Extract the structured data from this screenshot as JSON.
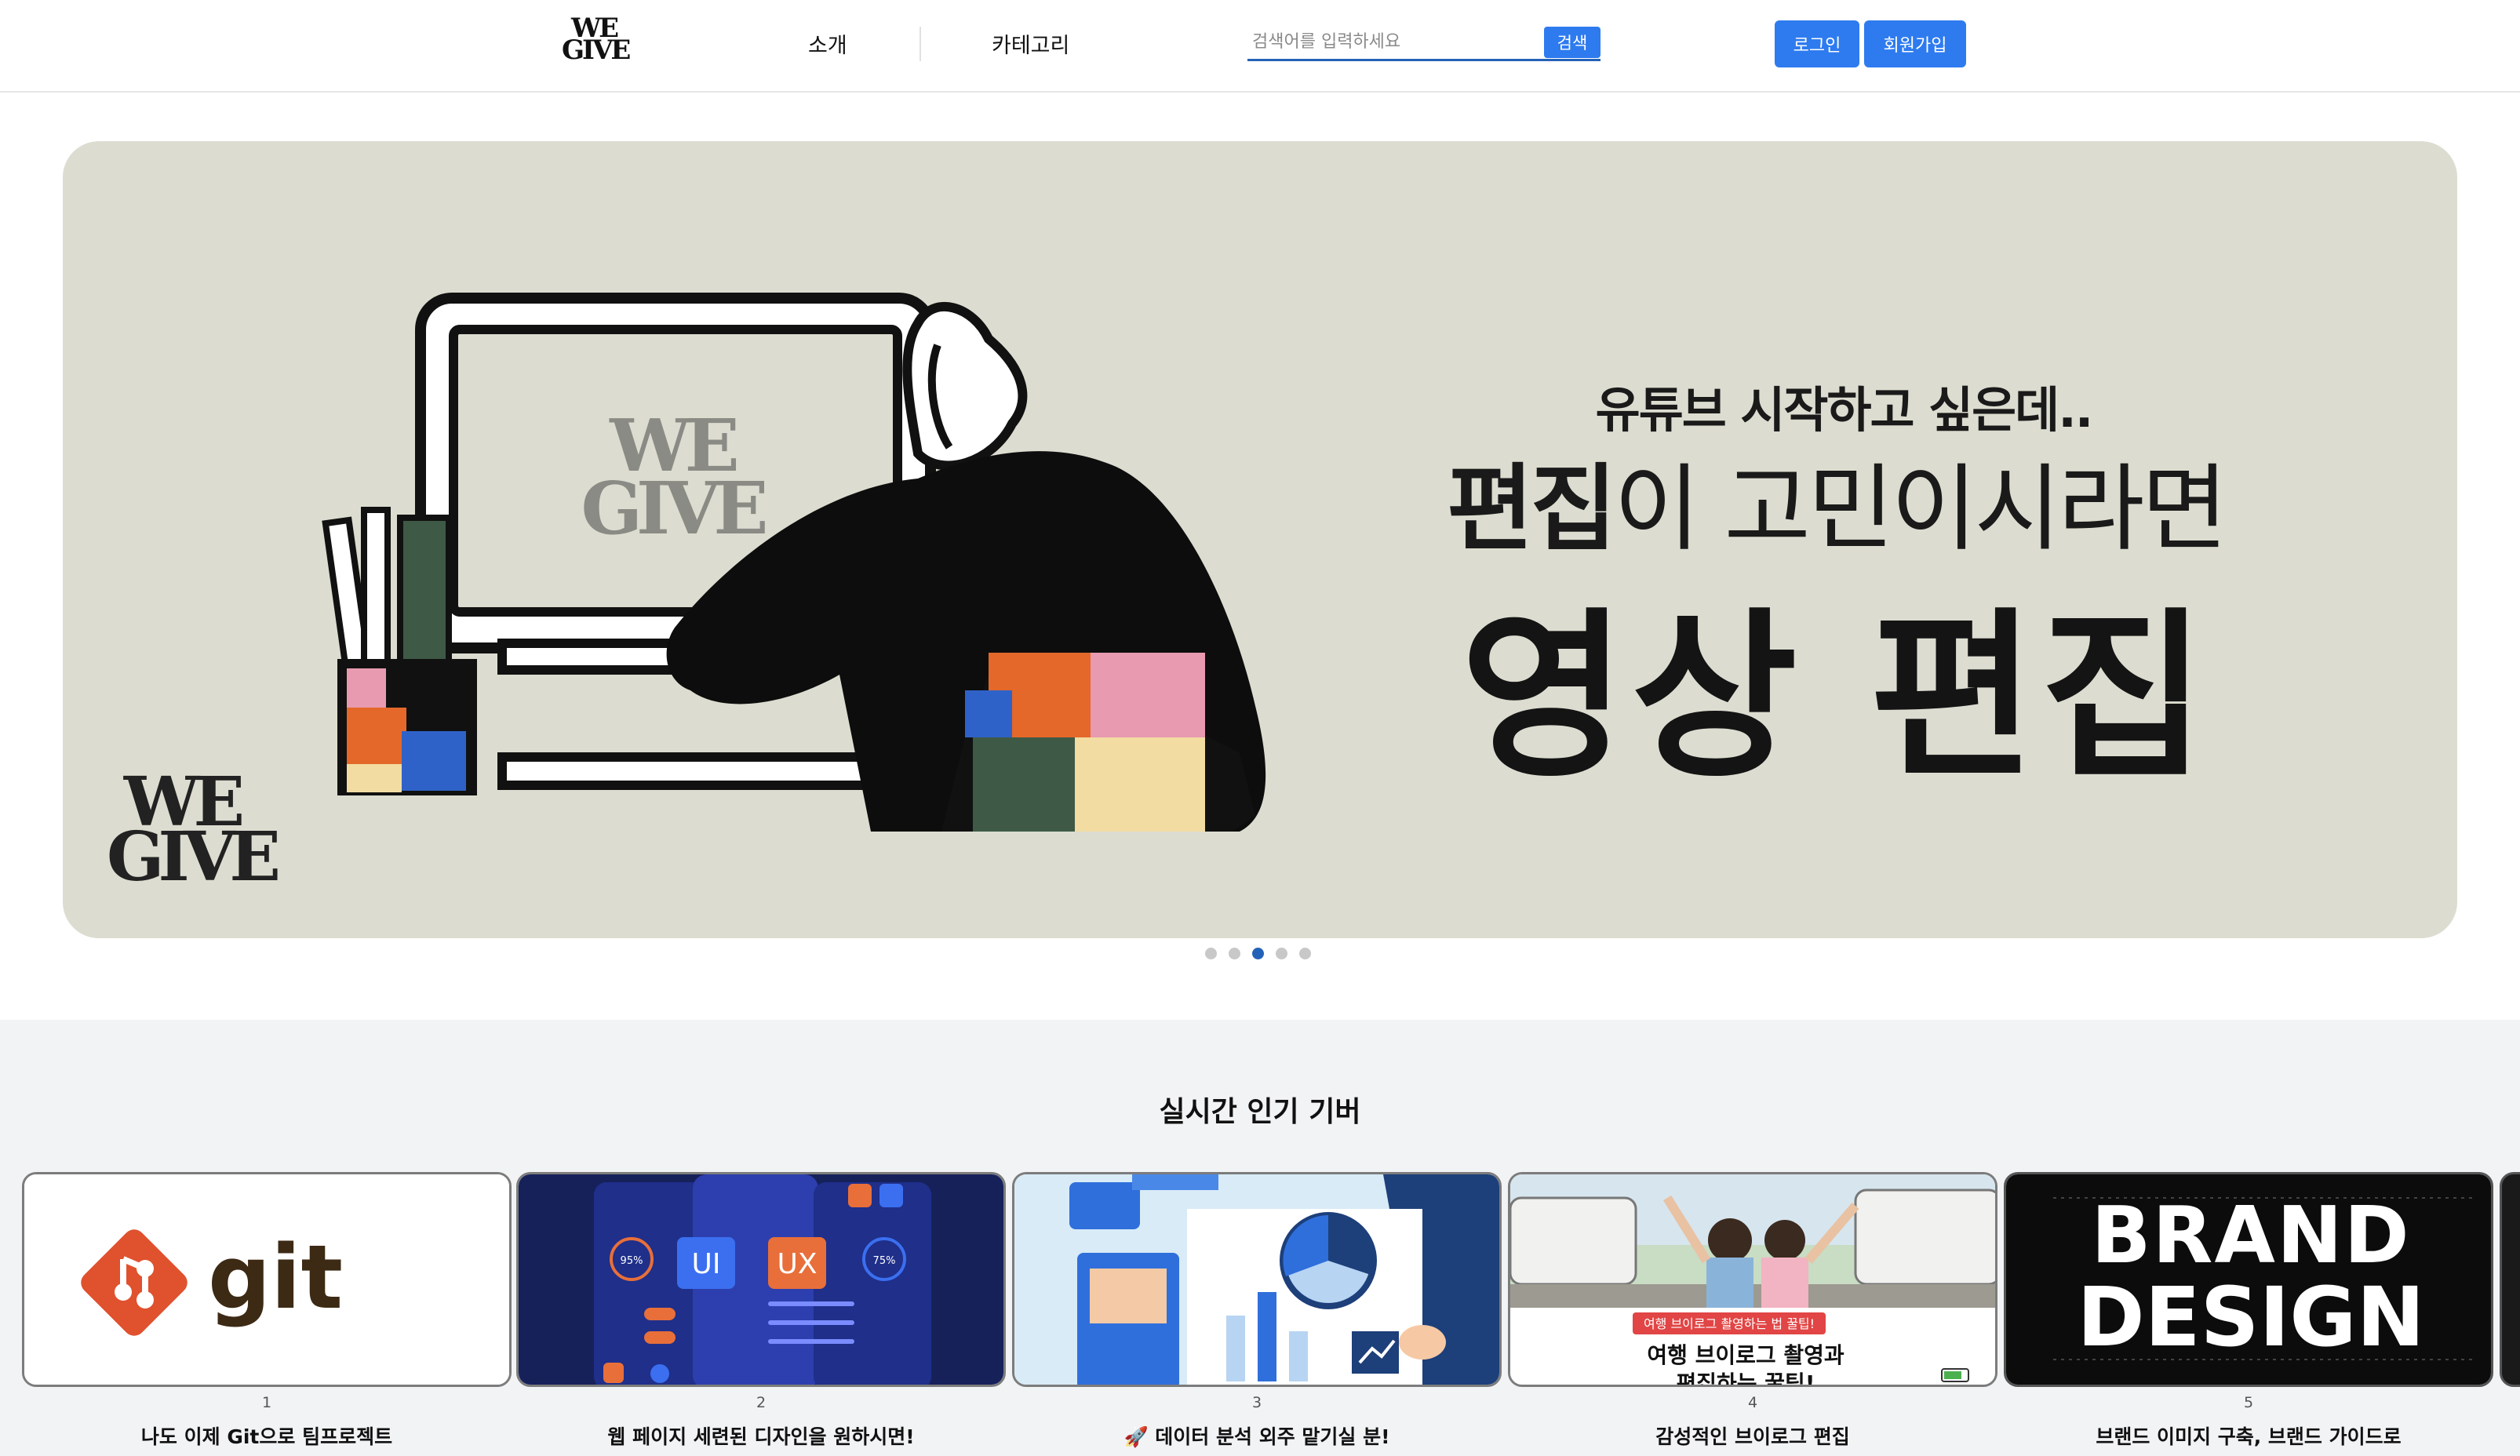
{
  "header": {
    "logo_line1": "WE",
    "logo_line2": "GIVE",
    "nav": [
      "소개",
      "카테고리"
    ],
    "search_placeholder": "검색어를 입력하세요",
    "search_button": "검색",
    "login": "로그인",
    "signup": "회원가입"
  },
  "banner": {
    "line1": "유튜브 시작하고 싶은데..",
    "line2_bold": "편집",
    "line2_rest": "이 고민이시라면",
    "line3": "영상 편집",
    "logo_line1": "WE",
    "logo_line2": "GIVE",
    "monitor_logo_line1": "WE",
    "monitor_logo_line2": "GIVE",
    "slide_count": 5,
    "active_slide": 3
  },
  "popular": {
    "title": "실시간 인기 기버",
    "cards": [
      {
        "num": "1",
        "title": "나도 이제 Git으로 팀프로젝트",
        "image_text": "git"
      },
      {
        "num": "2",
        "title": "웹 페이지 세련된 디자인을 원하시면!",
        "image_text_a": "UI",
        "image_text_b": "UX",
        "image_text_c": "95%",
        "image_text_d": "75%"
      },
      {
        "num": "3",
        "title": "🚀 데이터 분석 외주 맡기실 분!"
      },
      {
        "num": "4",
        "title": "감성적인 브이로그 편집",
        "image_text_a": "여행 브이로그 촬영하는 법 꿀팁!",
        "image_text_b": "여행 브이로그 촬영과",
        "image_text_c": "편집하는 꿀팁!"
      },
      {
        "num": "5",
        "title": "브랜드 이미지 구축, 브랜드 가이드로",
        "image_text_a": "BRAND",
        "image_text_b": "DESIGN"
      }
    ]
  },
  "colors": {
    "accent": "#2e7bef",
    "search_underline": "#2462b8",
    "banner_bg": "#dcdcd0",
    "section_bg": "#f2f3f5"
  }
}
